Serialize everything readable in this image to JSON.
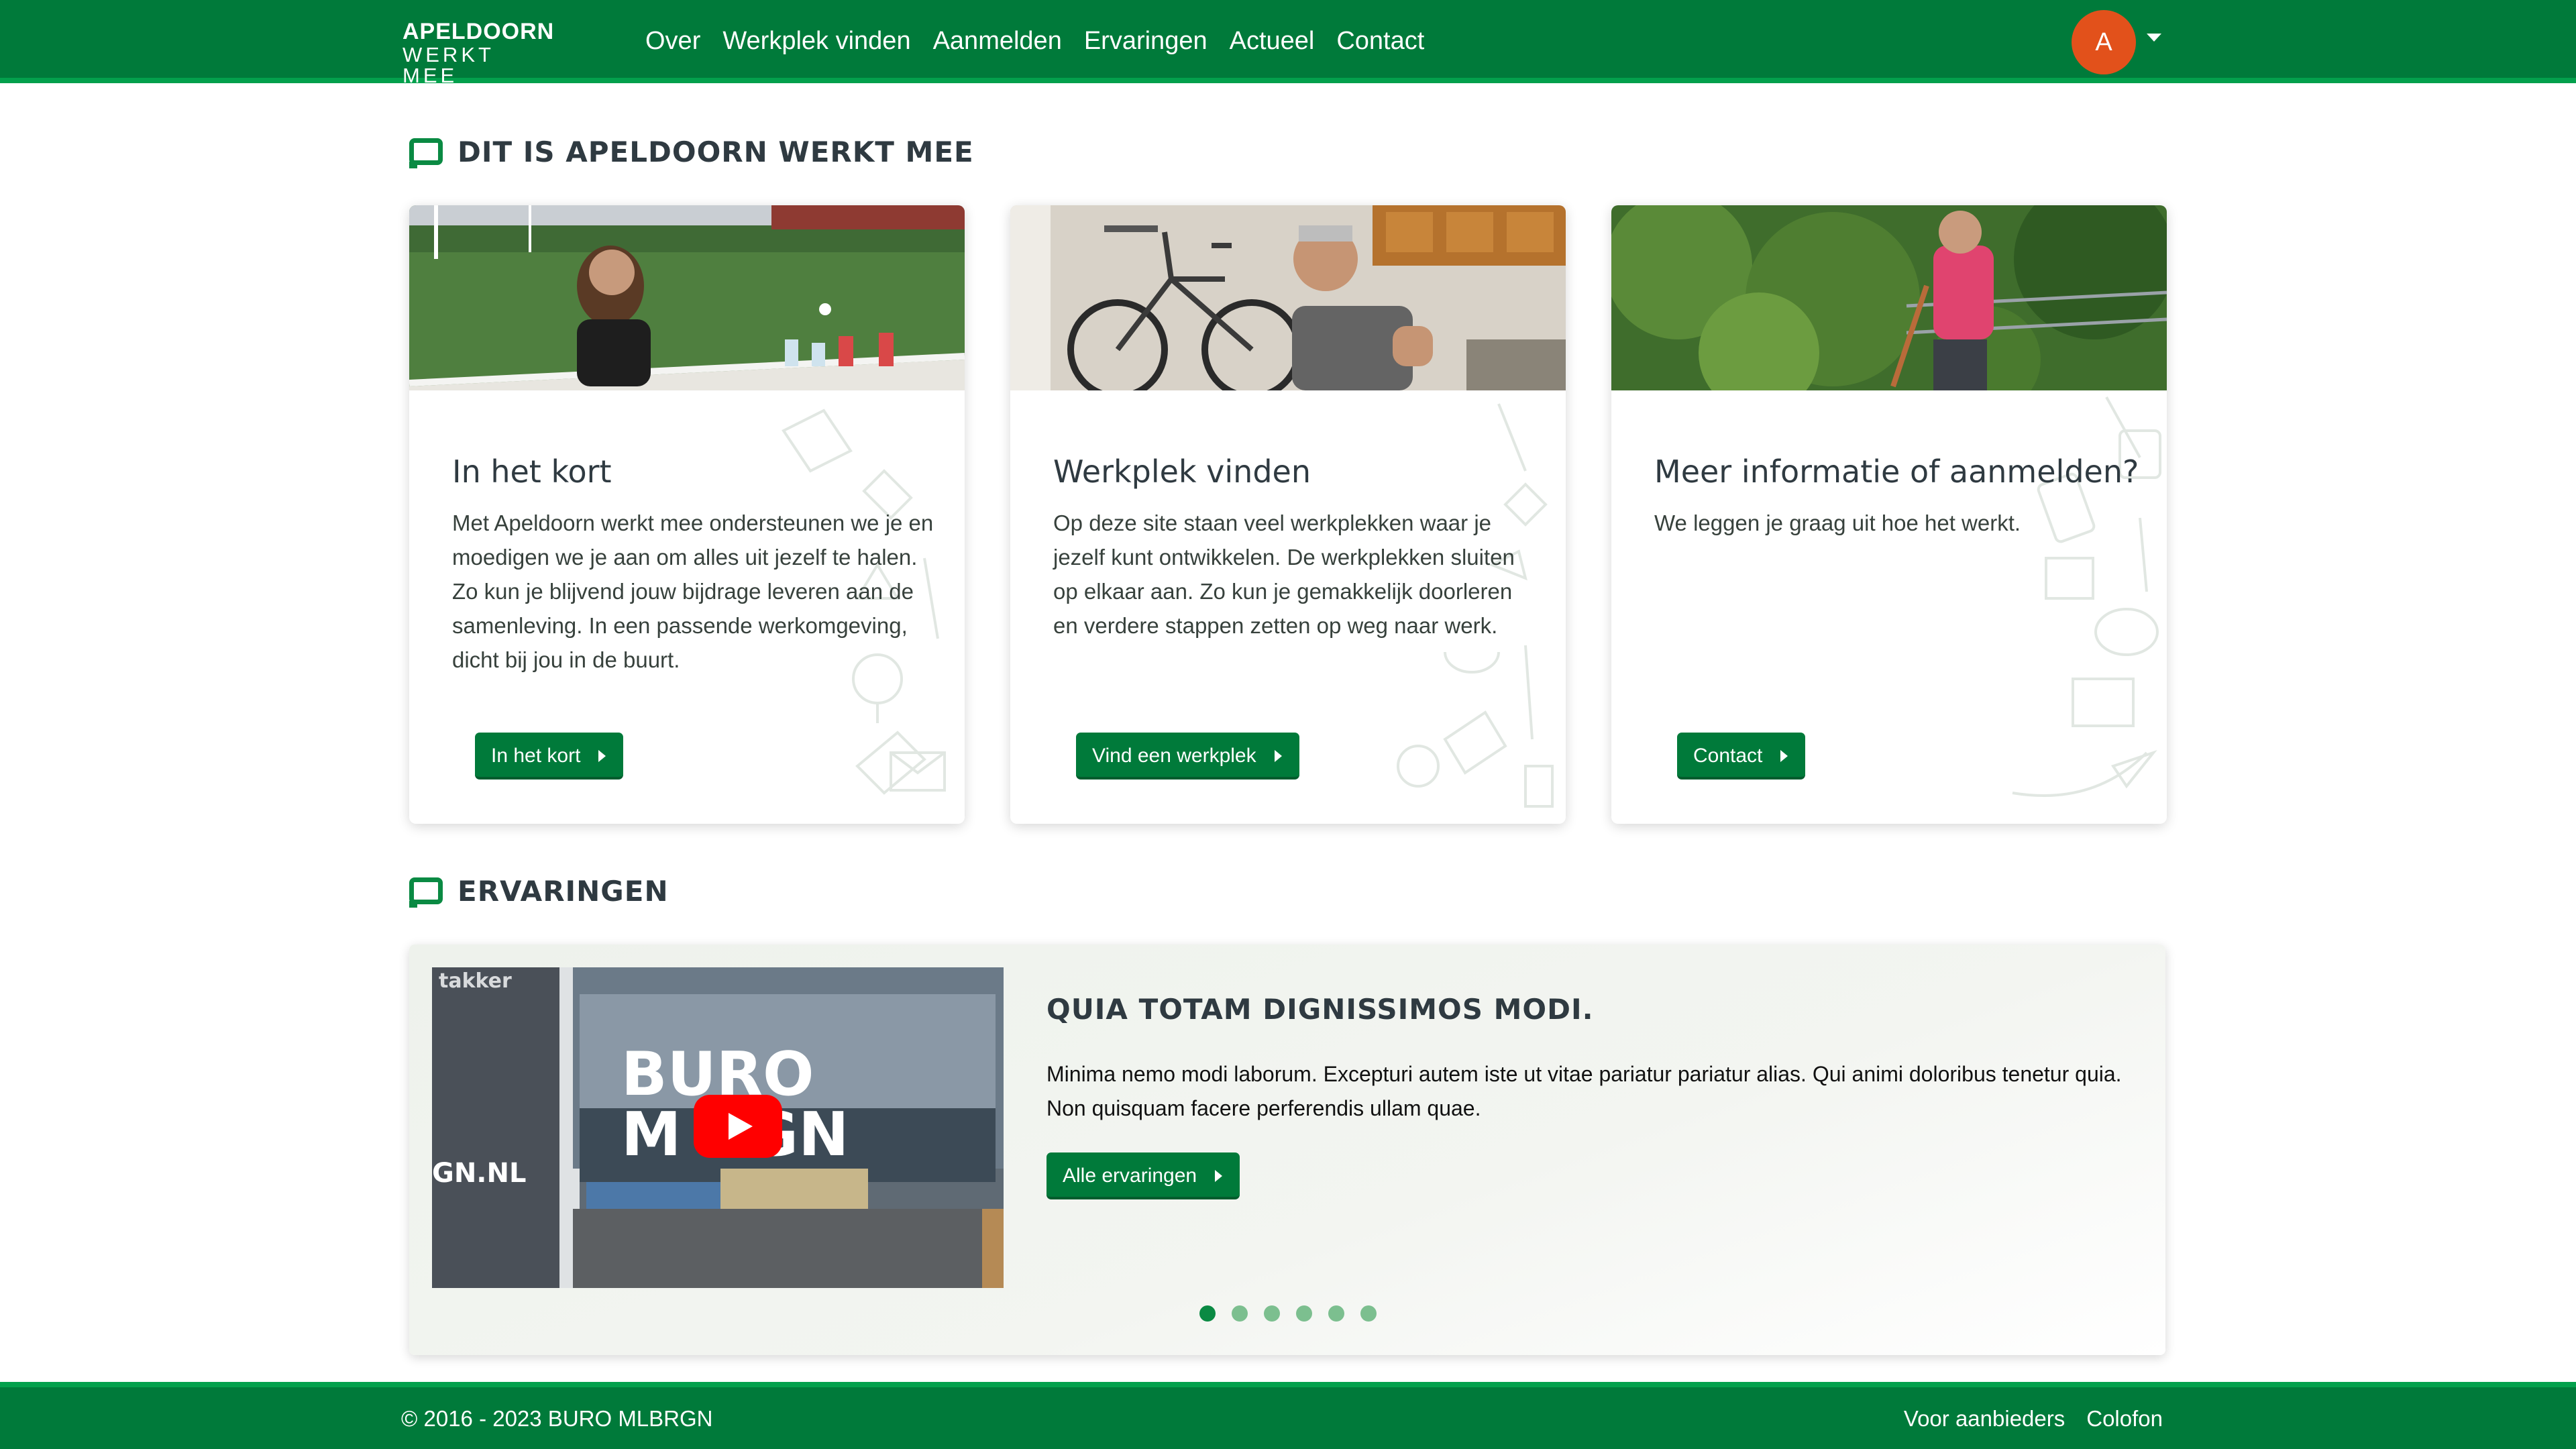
{
  "header": {
    "brand_line1": "APELDOORN",
    "brand_line2": "WERKT MEE",
    "nav": [
      "Over",
      "Werkplek vinden",
      "Aanmelden",
      "Ervaringen",
      "Actueel",
      "Contact"
    ],
    "avatar_initial": "A"
  },
  "intro": {
    "section_title": "DIT IS APELDOORN WERKT MEE",
    "cards": [
      {
        "title": "In het kort",
        "text": "Met Apeldoorn werkt mee ondersteunen we je en moedigen we je aan om alles uit jezelf te halen. Zo kun je blijvend jouw bijdrage leveren aan de samenleving. In een passende werkomgeving, dicht bij jou in de buurt.",
        "button": "In het kort"
      },
      {
        "title": "Werkplek vinden",
        "text": "Op deze site staan veel werkplekken waar je jezelf kunt ontwikkelen. De werkplekken sluiten op elkaar aan. Zo kun je gemakkelijk doorleren en verdere stappen zetten op weg naar werk.",
        "button": "Vind een werkplek"
      },
      {
        "title": "Meer informatie of aanmelden?",
        "text": "We leggen je graag uit hoe het werkt.",
        "button": "Contact"
      }
    ]
  },
  "experiences": {
    "section_title": "ERVARINGEN",
    "slide_title": "QUIA TOTAM DIGNISSIMOS MODI.",
    "slide_text": "Minima nemo modi laborum. Excepturi autem iste ut vitae pariatur pariatur alias. Qui animi doloribus tenetur quia. Non quisquam facere perferendis ullam quae.",
    "button": "Alle ervaringen",
    "video_sign_line1": "BURO",
    "video_sign_line2": "M  RGN",
    "video_sign_url": "GN.NL",
    "video_sign_top": "takker",
    "slide_count": 6,
    "active_slide": 1
  },
  "footer": {
    "copyright": "© 2016 - 2023 BURO MLBRGN",
    "links": [
      "Voor aanbieders",
      "Colofon"
    ]
  },
  "colors": {
    "primary_green": "#007a3a",
    "accent_green": "#03a04c",
    "avatar_orange": "#e2511b",
    "play_red": "#ff0000"
  }
}
